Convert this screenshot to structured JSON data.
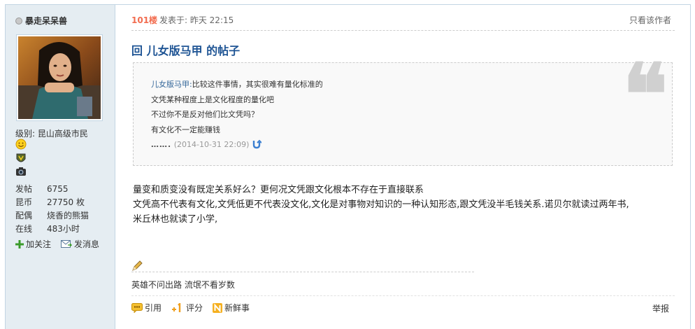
{
  "author": {
    "name": "暴走呆呆兽",
    "level_label": "级别:",
    "level_value": "昆山高级市民",
    "stats": [
      {
        "key": "发帖",
        "value": "6755"
      },
      {
        "key": "昆币",
        "value": "27750 枚"
      },
      {
        "key": "配偶",
        "value": "烧香的熊猫"
      },
      {
        "key": "在线",
        "value": "483小时"
      }
    ],
    "follow_label": "加关注",
    "message_label": "发消息"
  },
  "post": {
    "floor": "101楼",
    "time": "发表于: 昨天 22:15",
    "only_author": "只看该作者",
    "title": "回 儿女版马甲 的帖子",
    "quote": {
      "name": "儿女版马甲:",
      "line1": "比较这件事情，其实很难有量化标准的",
      "line2": "文凭某种程度上是文化程度的量化吧",
      "line3": "不过你不是反对他们比文凭吗？",
      "line4": "有文化不一定能赚钱",
      "dots": "…….",
      "time": "(2014-10-31 22:09)"
    },
    "body_line1": "量变和质变没有既定关系好么？更何况文凭跟文化根本不存在于直接联系",
    "body_line2": "文凭高不代表有文化,文凭低更不代表没文化,文化是对事物对知识的一种认知形态,跟文凭没半毛钱关系.诺贝尔就读过两年书,",
    "body_line3": "米丘林也就读了小学,",
    "signature": "英雄不问出路 流氓不看岁数"
  },
  "actions": {
    "quote": "引用",
    "rate": "评分",
    "news": "新鲜事",
    "report": "举报"
  },
  "colors": {
    "sidebar_bg": "#e5edf2",
    "floor": "#f26c4f",
    "title": "#1e5494",
    "quote_name": "#336699"
  }
}
